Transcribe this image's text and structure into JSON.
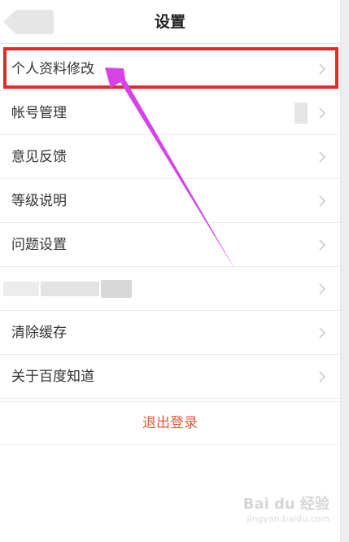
{
  "header": {
    "title": "设置",
    "back_icon": "back-arrow-icon"
  },
  "settings_list": [
    {
      "label": "个人资料修改",
      "highlighted": true
    },
    {
      "label": "帐号管理"
    },
    {
      "label": "意见反馈"
    },
    {
      "label": "等级说明"
    },
    {
      "label": "问题设置"
    },
    {
      "label": ""
    },
    {
      "label": "清除缓存"
    },
    {
      "label": "关于百度知道"
    }
  ],
  "logout": {
    "label": "退出登录"
  },
  "colors": {
    "highlight_border": "#e22a2a",
    "arrow": "#d642e6",
    "logout_text": "#e35a3a"
  },
  "watermark": {
    "brand": "Bai du 经验",
    "domain": "jingyan.baidu.com"
  }
}
